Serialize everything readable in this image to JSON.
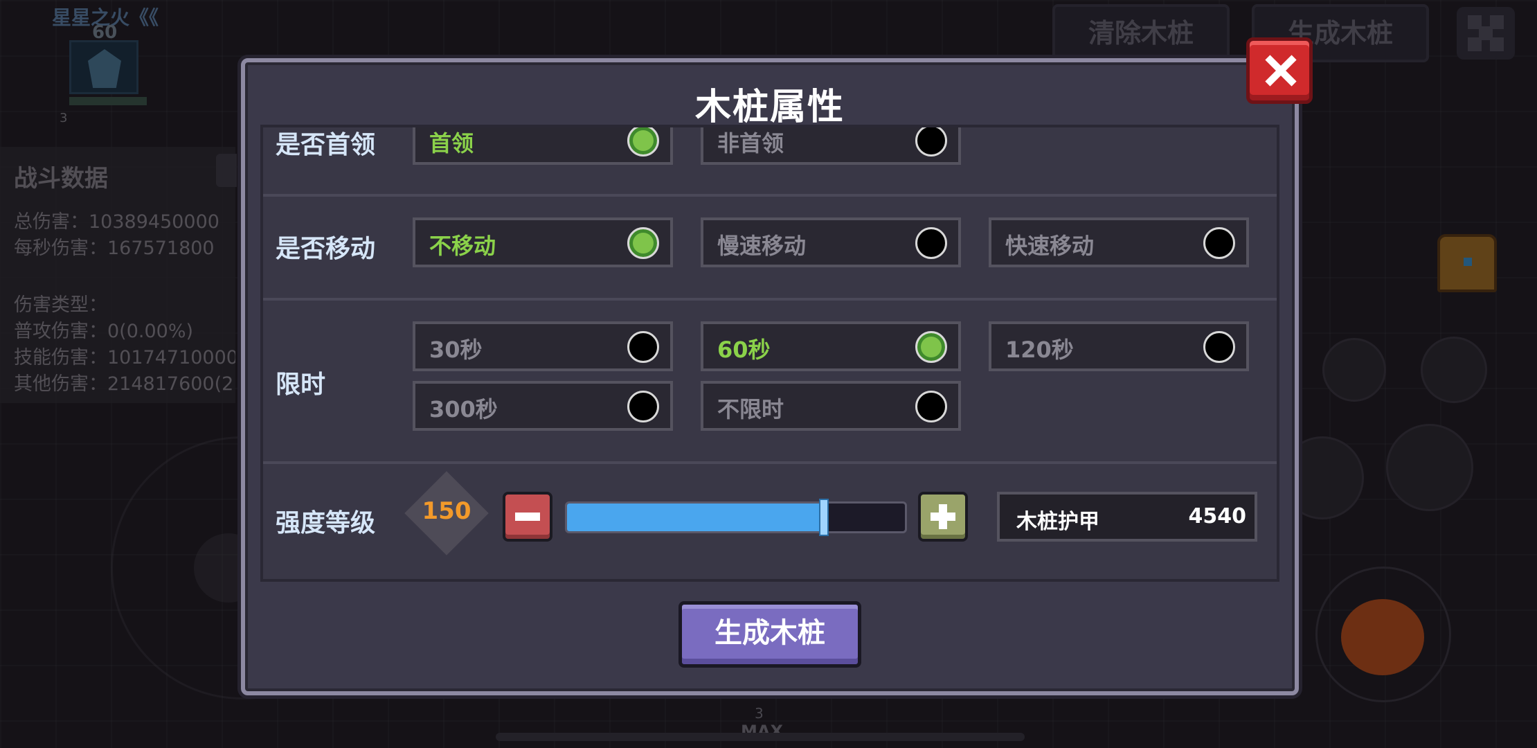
{
  "player": {
    "name": "星星之火《《",
    "level": "60",
    "item_count": "3"
  },
  "battle_stats": {
    "title": "战斗数据",
    "lines": [
      "总伤害：10389450000",
      "每秒伤害：167571800",
      "",
      "伤害类型：",
      "普攻伤害：0(0.00%)",
      "技能伤害：10174710000",
      "其他伤害：214817600(2."
    ]
  },
  "top_buttons": {
    "clear_stakes": "清除木桩",
    "generate_stakes": "生成木桩"
  },
  "dialog": {
    "title": "木桩属性",
    "sections": {
      "boss": {
        "label": "是否首领",
        "options": [
          {
            "label": "首领",
            "selected": true
          },
          {
            "label": "非首领",
            "selected": false
          }
        ]
      },
      "move": {
        "label": "是否移动",
        "options": [
          {
            "label": "不移动",
            "selected": true
          },
          {
            "label": "慢速移动",
            "selected": false
          },
          {
            "label": "快速移动",
            "selected": false
          }
        ]
      },
      "time": {
        "label": "限时",
        "options": [
          {
            "label": "30秒",
            "selected": false
          },
          {
            "label": "60秒",
            "selected": true
          },
          {
            "label": "120秒",
            "selected": false
          },
          {
            "label": "300秒",
            "selected": false
          },
          {
            "label": "不限时",
            "selected": false
          }
        ]
      },
      "strength": {
        "label": "强度等级",
        "level": "150",
        "slider_fraction": 0.76,
        "armor_label": "木桩护甲",
        "armor_value": "4540"
      }
    },
    "generate_button": "生成木桩"
  },
  "hud": {
    "bottom_count": "3",
    "max_label": "MAX"
  },
  "colors": {
    "selected_text": "#8bd24a",
    "slider_fill": "#4aa6ee",
    "close_button": "#d02a2c",
    "generate_button": "#7a6cc0",
    "level_value": "#f39a2a"
  }
}
